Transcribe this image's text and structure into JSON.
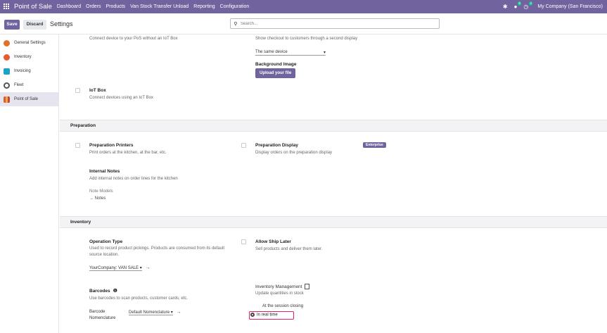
{
  "navbar": {
    "brand": "Point of Sale",
    "menu": [
      "Dashboard",
      "Orders",
      "Products",
      "Van Stock Transfer Unload",
      "Reporting",
      "Configuration"
    ],
    "messages_badge": "6",
    "activity_badge": "4",
    "company": "My Company (San Francisco)"
  },
  "control": {
    "save_label": "Save",
    "discard_label": "Discard",
    "title": "Settings",
    "search_placeholder": "Search..."
  },
  "sidebar": {
    "items": [
      {
        "label": "General Settings",
        "color": "#e46f2c"
      },
      {
        "label": "Inventory",
        "color": "#e9592f"
      },
      {
        "label": "Invoicing",
        "color": "#1aa2c8"
      },
      {
        "label": "Fleet",
        "color": "#555555"
      },
      {
        "label": "Point of Sale",
        "color": "#d45d3e"
      }
    ]
  },
  "top": {
    "iot_connect_desc": "Connect device to your PoS without an IoT Box",
    "checkout_desc": "Show checkout to customers through a second display",
    "same_device": "The same device",
    "bg_image_label": "Background Image",
    "upload_label": "Upload your file",
    "iot_box_label": "IoT Box",
    "iot_box_desc": "Connect devices using an IoT Box"
  },
  "preparation": {
    "title": "Preparation",
    "printers_label": "Preparation Printers",
    "printers_desc": "Print orders at the kitchen, at the bar, etc.",
    "display_label": "Preparation Display",
    "display_desc": "Display orders on the preparation display",
    "enterprise_badge": "Enterprise",
    "notes_label": "Internal Notes",
    "notes_desc": "Add internal notes on order lines for the kitchen",
    "note_models": "Note Models",
    "notes_link": "→ Notes"
  },
  "inventory": {
    "title": "Inventory",
    "operation_label": "Operation Type",
    "operation_desc": "Used to record product pickings. Products are consumed from its default source location.",
    "operation_value": "YourCompany: VAN SALE",
    "ship_later_label": "Allow Ship Later",
    "ship_later_desc": "Sell products and deliver them later.",
    "barcodes_label": "Barcodes",
    "barcodes_desc": "Use barcodes to scan products, customer cards, etc.",
    "barcode_nomenclature_label": "Barcode Nomenclature",
    "barcode_nomenclature_value": "Default Nomenclature",
    "inv_mgmt_label": "Inventory Management",
    "inv_mgmt_desc": "Update quantities in stock",
    "option_session": "At the session closing",
    "option_realtime": "In real time"
  }
}
